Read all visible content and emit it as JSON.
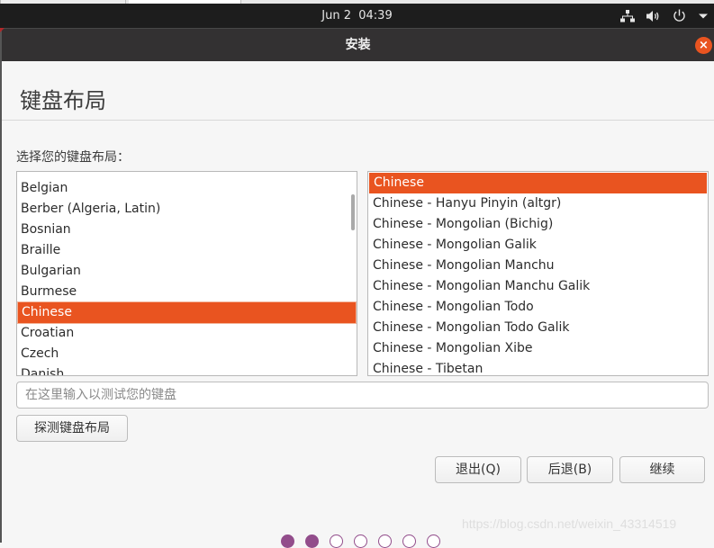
{
  "system_bar": {
    "date": "Jun 2",
    "time": "04:39",
    "icons": [
      "network-icon",
      "volume-icon",
      "power-icon",
      "menu-arrow-icon"
    ]
  },
  "window": {
    "title": "安装",
    "close_icon": "×"
  },
  "page": {
    "title": "键盘布局",
    "prompt": "选择您的键盘布局："
  },
  "layouts": {
    "items": [
      "Belgian",
      "Berber (Algeria, Latin)",
      "Bosnian",
      "Braille",
      "Bulgarian",
      "Burmese",
      "Chinese",
      "Croatian",
      "Czech",
      "Danish"
    ],
    "selected": "Chinese"
  },
  "variants": {
    "items": [
      "Chinese",
      "Chinese - Hanyu Pinyin (altgr)",
      "Chinese - Mongolian (Bichig)",
      "Chinese - Mongolian Galik",
      "Chinese - Mongolian Manchu",
      "Chinese - Mongolian Manchu Galik",
      "Chinese - Mongolian Todo",
      "Chinese - Mongolian Todo Galik",
      "Chinese - Mongolian Xibe",
      "Chinese - Tibetan"
    ],
    "selected": "Chinese"
  },
  "test_input": {
    "value": "",
    "placeholder": "在这里输入以测试您的键盘"
  },
  "buttons": {
    "detect": "探测键盘布局",
    "quit": "退出(Q)",
    "back": "后退(B)",
    "continue": "继续"
  },
  "progress": {
    "total_steps": 7,
    "completed_steps": 2
  },
  "watermark": "https://blog.csdn.net/weixin_43314519",
  "colors": {
    "accent": "#e95420",
    "progress_dot": "#924d8b",
    "topbar": "#1d1d1d",
    "titlebar": "#333132"
  }
}
